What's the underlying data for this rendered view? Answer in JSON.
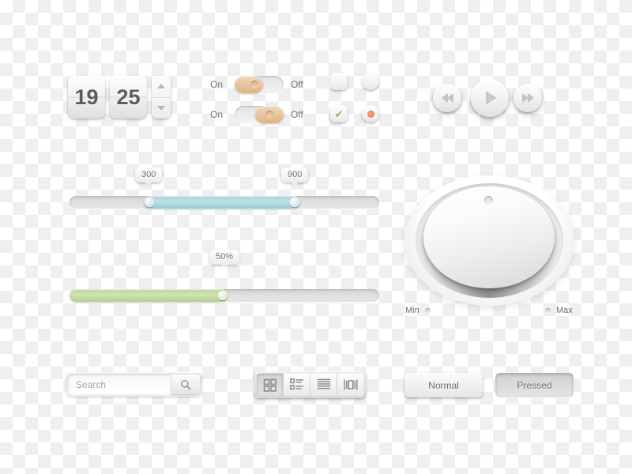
{
  "stepper": {
    "value_left": "19",
    "value_right": "25",
    "increment_icon": "triangle-up-icon",
    "decrement_icon": "triangle-down-icon"
  },
  "toggles": [
    {
      "on_label": "On",
      "off_label": "Off",
      "state": "on"
    },
    {
      "on_label": "On",
      "off_label": "Off",
      "state": "off"
    }
  ],
  "choices": {
    "checkbox_unchecked": "checkbox-unchecked",
    "radio_unselected": "radio-unselected",
    "checkbox_checked_mark": "✔",
    "radio_selected": "radio-selected",
    "check_color": "#8faa72",
    "radio_color": "#e8714a"
  },
  "media": {
    "rewind_label": "Rewind",
    "play_label": "Play",
    "forward_label": "Fast Forward"
  },
  "range_slider": {
    "low_tip": "300",
    "high_tip": "900",
    "fill_color": "#a8d3dd",
    "low_percent": 24,
    "high_percent": 75
  },
  "progress_slider": {
    "tip": "50%",
    "fill_color": "#bcd79b",
    "percent": 50
  },
  "knob": {
    "min_label": "Min",
    "max_label": "Max"
  },
  "search": {
    "placeholder": "Search",
    "value": "",
    "button_icon": "search-icon"
  },
  "segmented": {
    "items": [
      {
        "icon": "grid-view-icon",
        "active": true
      },
      {
        "icon": "list-view-icon",
        "active": false
      },
      {
        "icon": "lines-view-icon",
        "active": false
      },
      {
        "icon": "coverflow-view-icon",
        "active": false
      }
    ]
  },
  "buttons": {
    "normal_label": "Normal",
    "pressed_label": "Pressed"
  }
}
